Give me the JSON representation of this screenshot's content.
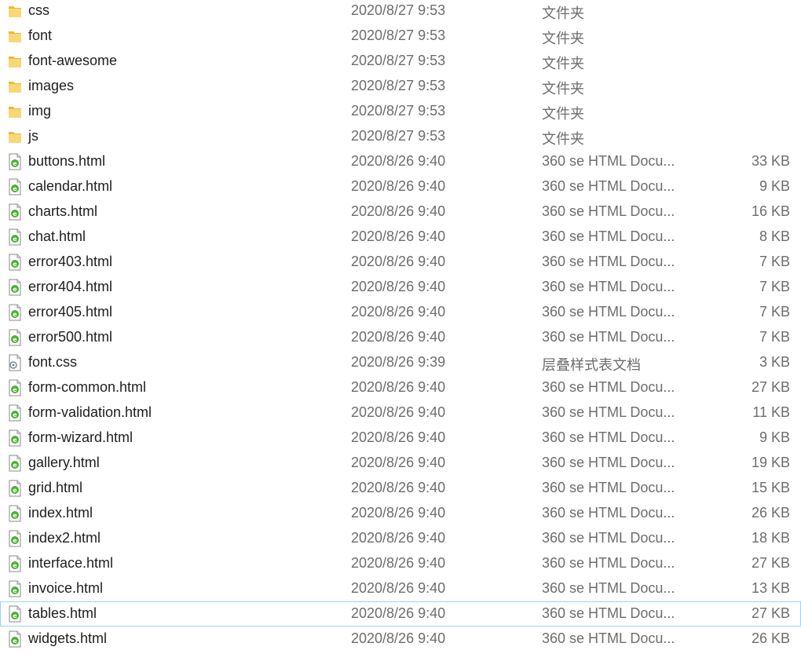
{
  "colors": {
    "folder": "#f8d775",
    "html_icon_accent": "#4caf32",
    "text_primary": "#1e1e1e",
    "text_secondary": "#6d6d6d",
    "selection_border": "#99d1ff"
  },
  "rows": [
    {
      "name": "css",
      "date": "2020/8/27 9:53",
      "type": "文件夹",
      "size": "",
      "icon": "folder-icon",
      "selected": false
    },
    {
      "name": "font",
      "date": "2020/8/27 9:53",
      "type": "文件夹",
      "size": "",
      "icon": "folder-icon",
      "selected": false
    },
    {
      "name": "font-awesome",
      "date": "2020/8/27 9:53",
      "type": "文件夹",
      "size": "",
      "icon": "folder-icon",
      "selected": false
    },
    {
      "name": "images",
      "date": "2020/8/27 9:53",
      "type": "文件夹",
      "size": "",
      "icon": "folder-icon",
      "selected": false
    },
    {
      "name": "img",
      "date": "2020/8/27 9:53",
      "type": "文件夹",
      "size": "",
      "icon": "folder-icon",
      "selected": false
    },
    {
      "name": "js",
      "date": "2020/8/27 9:53",
      "type": "文件夹",
      "size": "",
      "icon": "folder-icon",
      "selected": false
    },
    {
      "name": "buttons.html",
      "date": "2020/8/26 9:40",
      "type": "360 se HTML Docu...",
      "size": "33 KB",
      "icon": "html-file-icon",
      "selected": false
    },
    {
      "name": "calendar.html",
      "date": "2020/8/26 9:40",
      "type": "360 se HTML Docu...",
      "size": "9 KB",
      "icon": "html-file-icon",
      "selected": false
    },
    {
      "name": "charts.html",
      "date": "2020/8/26 9:40",
      "type": "360 se HTML Docu...",
      "size": "16 KB",
      "icon": "html-file-icon",
      "selected": false
    },
    {
      "name": "chat.html",
      "date": "2020/8/26 9:40",
      "type": "360 se HTML Docu...",
      "size": "8 KB",
      "icon": "html-file-icon",
      "selected": false
    },
    {
      "name": "error403.html",
      "date": "2020/8/26 9:40",
      "type": "360 se HTML Docu...",
      "size": "7 KB",
      "icon": "html-file-icon",
      "selected": false
    },
    {
      "name": "error404.html",
      "date": "2020/8/26 9:40",
      "type": "360 se HTML Docu...",
      "size": "7 KB",
      "icon": "html-file-icon",
      "selected": false
    },
    {
      "name": "error405.html",
      "date": "2020/8/26 9:40",
      "type": "360 se HTML Docu...",
      "size": "7 KB",
      "icon": "html-file-icon",
      "selected": false
    },
    {
      "name": "error500.html",
      "date": "2020/8/26 9:40",
      "type": "360 se HTML Docu...",
      "size": "7 KB",
      "icon": "html-file-icon",
      "selected": false
    },
    {
      "name": "font.css",
      "date": "2020/8/26 9:39",
      "type": "层叠样式表文档",
      "size": "3 KB",
      "icon": "css-file-icon",
      "selected": false
    },
    {
      "name": "form-common.html",
      "date": "2020/8/26 9:40",
      "type": "360 se HTML Docu...",
      "size": "27 KB",
      "icon": "html-file-icon",
      "selected": false
    },
    {
      "name": "form-validation.html",
      "date": "2020/8/26 9:40",
      "type": "360 se HTML Docu...",
      "size": "11 KB",
      "icon": "html-file-icon",
      "selected": false
    },
    {
      "name": "form-wizard.html",
      "date": "2020/8/26 9:40",
      "type": "360 se HTML Docu...",
      "size": "9 KB",
      "icon": "html-file-icon",
      "selected": false
    },
    {
      "name": "gallery.html",
      "date": "2020/8/26 9:40",
      "type": "360 se HTML Docu...",
      "size": "19 KB",
      "icon": "html-file-icon",
      "selected": false
    },
    {
      "name": "grid.html",
      "date": "2020/8/26 9:40",
      "type": "360 se HTML Docu...",
      "size": "15 KB",
      "icon": "html-file-icon",
      "selected": false
    },
    {
      "name": "index.html",
      "date": "2020/8/26 9:40",
      "type": "360 se HTML Docu...",
      "size": "26 KB",
      "icon": "html-file-icon",
      "selected": false
    },
    {
      "name": "index2.html",
      "date": "2020/8/26 9:40",
      "type": "360 se HTML Docu...",
      "size": "18 KB",
      "icon": "html-file-icon",
      "selected": false
    },
    {
      "name": "interface.html",
      "date": "2020/8/26 9:40",
      "type": "360 se HTML Docu...",
      "size": "27 KB",
      "icon": "html-file-icon",
      "selected": false
    },
    {
      "name": "invoice.html",
      "date": "2020/8/26 9:40",
      "type": "360 se HTML Docu...",
      "size": "13 KB",
      "icon": "html-file-icon",
      "selected": false
    },
    {
      "name": "tables.html",
      "date": "2020/8/26 9:40",
      "type": "360 se HTML Docu...",
      "size": "27 KB",
      "icon": "html-file-icon",
      "selected": true
    },
    {
      "name": "widgets.html",
      "date": "2020/8/26 9:40",
      "type": "360 se HTML Docu...",
      "size": "26 KB",
      "icon": "html-file-icon",
      "selected": false
    }
  ]
}
